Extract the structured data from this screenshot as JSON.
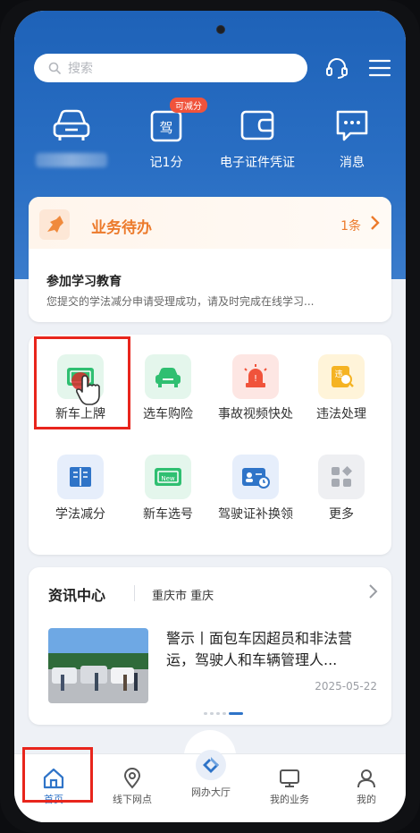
{
  "search": {
    "placeholder": "搜索"
  },
  "header_icons": [
    "headset-icon",
    "menu-icon"
  ],
  "quick_actions": [
    {
      "label": "",
      "icon": "car-icon",
      "blurred_name": true
    },
    {
      "label": "记1分",
      "icon": "license-icon",
      "badge": "可减分"
    },
    {
      "label": "电子证件凭证",
      "icon": "wallet-icon"
    },
    {
      "label": "消息",
      "icon": "message-icon"
    }
  ],
  "todo": {
    "title": "业务待办",
    "count": "1条",
    "item_title": "参加学习教育",
    "item_desc": "您提交的学法减分申请受理成功，请及时完成在线学习..."
  },
  "services": [
    {
      "label": "新车上牌",
      "icon": "new-plate-icon",
      "highlighted": true
    },
    {
      "label": "选车购险",
      "icon": "car-insurance-icon"
    },
    {
      "label": "事故视频快处",
      "icon": "accident-alarm-icon"
    },
    {
      "label": "违法处理",
      "icon": "violation-icon"
    },
    {
      "label": "学法减分",
      "icon": "study-book-icon"
    },
    {
      "label": "新车选号",
      "icon": "plate-select-icon"
    },
    {
      "label": "驾驶证补换领",
      "icon": "license-renew-icon"
    },
    {
      "label": "更多",
      "icon": "more-grid-icon"
    }
  ],
  "news": {
    "heading": "资讯中心",
    "location": "重庆市 重庆",
    "title": "警示丨面包车因超员和非法营运，驾驶人和车辆管理人...",
    "date": "2025-05-22"
  },
  "tabs": [
    {
      "label": "首页",
      "icon": "home-icon",
      "active": true
    },
    {
      "label": "线下网点",
      "icon": "location-pin-icon"
    },
    {
      "label": "网办大厅",
      "icon": "online-hall-icon"
    },
    {
      "label": "我的业务",
      "icon": "monitor-icon"
    },
    {
      "label": "我的",
      "icon": "user-icon"
    }
  ],
  "colors": {
    "header_blue": "#2a6fc4",
    "accent_orange": "#ec7a2b",
    "highlight_red": "#e8251c",
    "active_tab": "#2f74c8"
  }
}
